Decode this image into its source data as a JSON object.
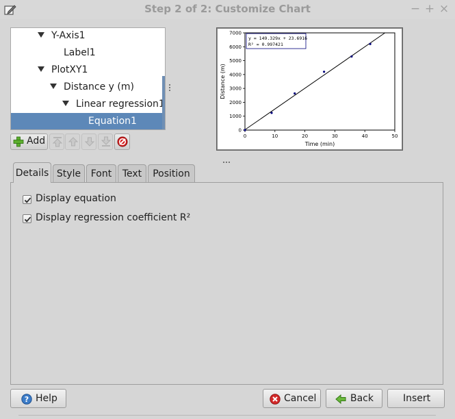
{
  "window": {
    "title": "Step 2 of 2: Customize Chart",
    "controls": {
      "minimize": "−",
      "maximize": "+",
      "close": "×"
    }
  },
  "tree": {
    "items": [
      {
        "label": "Y-Axis1",
        "expanded": true
      },
      {
        "label": "Label1",
        "expanded": false
      },
      {
        "label": "PlotXY1",
        "expanded": true
      },
      {
        "label": "Distance y (m)",
        "expanded": true
      },
      {
        "label": "Linear regression1",
        "expanded": true
      },
      {
        "label": "Equation1",
        "selected": true
      }
    ]
  },
  "toolbar": {
    "add_label": "Add",
    "icons": [
      "add-icon",
      "move-top-icon",
      "move-up-icon",
      "move-down-icon",
      "move-bottom-icon",
      "delete-icon"
    ]
  },
  "chart_data": {
    "type": "scatter",
    "x": [
      0,
      8.9,
      16.6,
      26.4,
      35.6,
      41.8
    ],
    "y": [
      0,
      1240,
      2640,
      4200,
      5300,
      6200
    ],
    "trendline": {
      "slope": 149.329,
      "intercept": 23.6916,
      "x_range": [
        0,
        50
      ]
    },
    "equation_label": "y = 149.329x + 23.6916",
    "r2_label": "R² = 0.997421",
    "xlabel": "Time (min)",
    "ylabel": "Distance (m)",
    "xlim": [
      0,
      50
    ],
    "ylim": [
      0,
      7000
    ],
    "xticks": [
      0,
      10,
      20,
      30,
      40,
      50
    ],
    "yticks": [
      0,
      1000,
      2000,
      3000,
      4000,
      5000,
      6000,
      7000
    ],
    "grid": false,
    "marker_color": "#00007a"
  },
  "tabs": [
    "Details",
    "Style",
    "Font",
    "Text",
    "Position"
  ],
  "active_tab": "Details",
  "details": {
    "display_equation": {
      "label": "Display equation",
      "checked": true
    },
    "display_r2": {
      "label": "Display regression coefficient R²",
      "checked": true
    }
  },
  "buttons": {
    "help": "Help",
    "cancel": "Cancel",
    "back": "Back",
    "insert": "Insert"
  },
  "colors": {
    "selection": "#5d88b8",
    "background": "#d6d6d6"
  }
}
